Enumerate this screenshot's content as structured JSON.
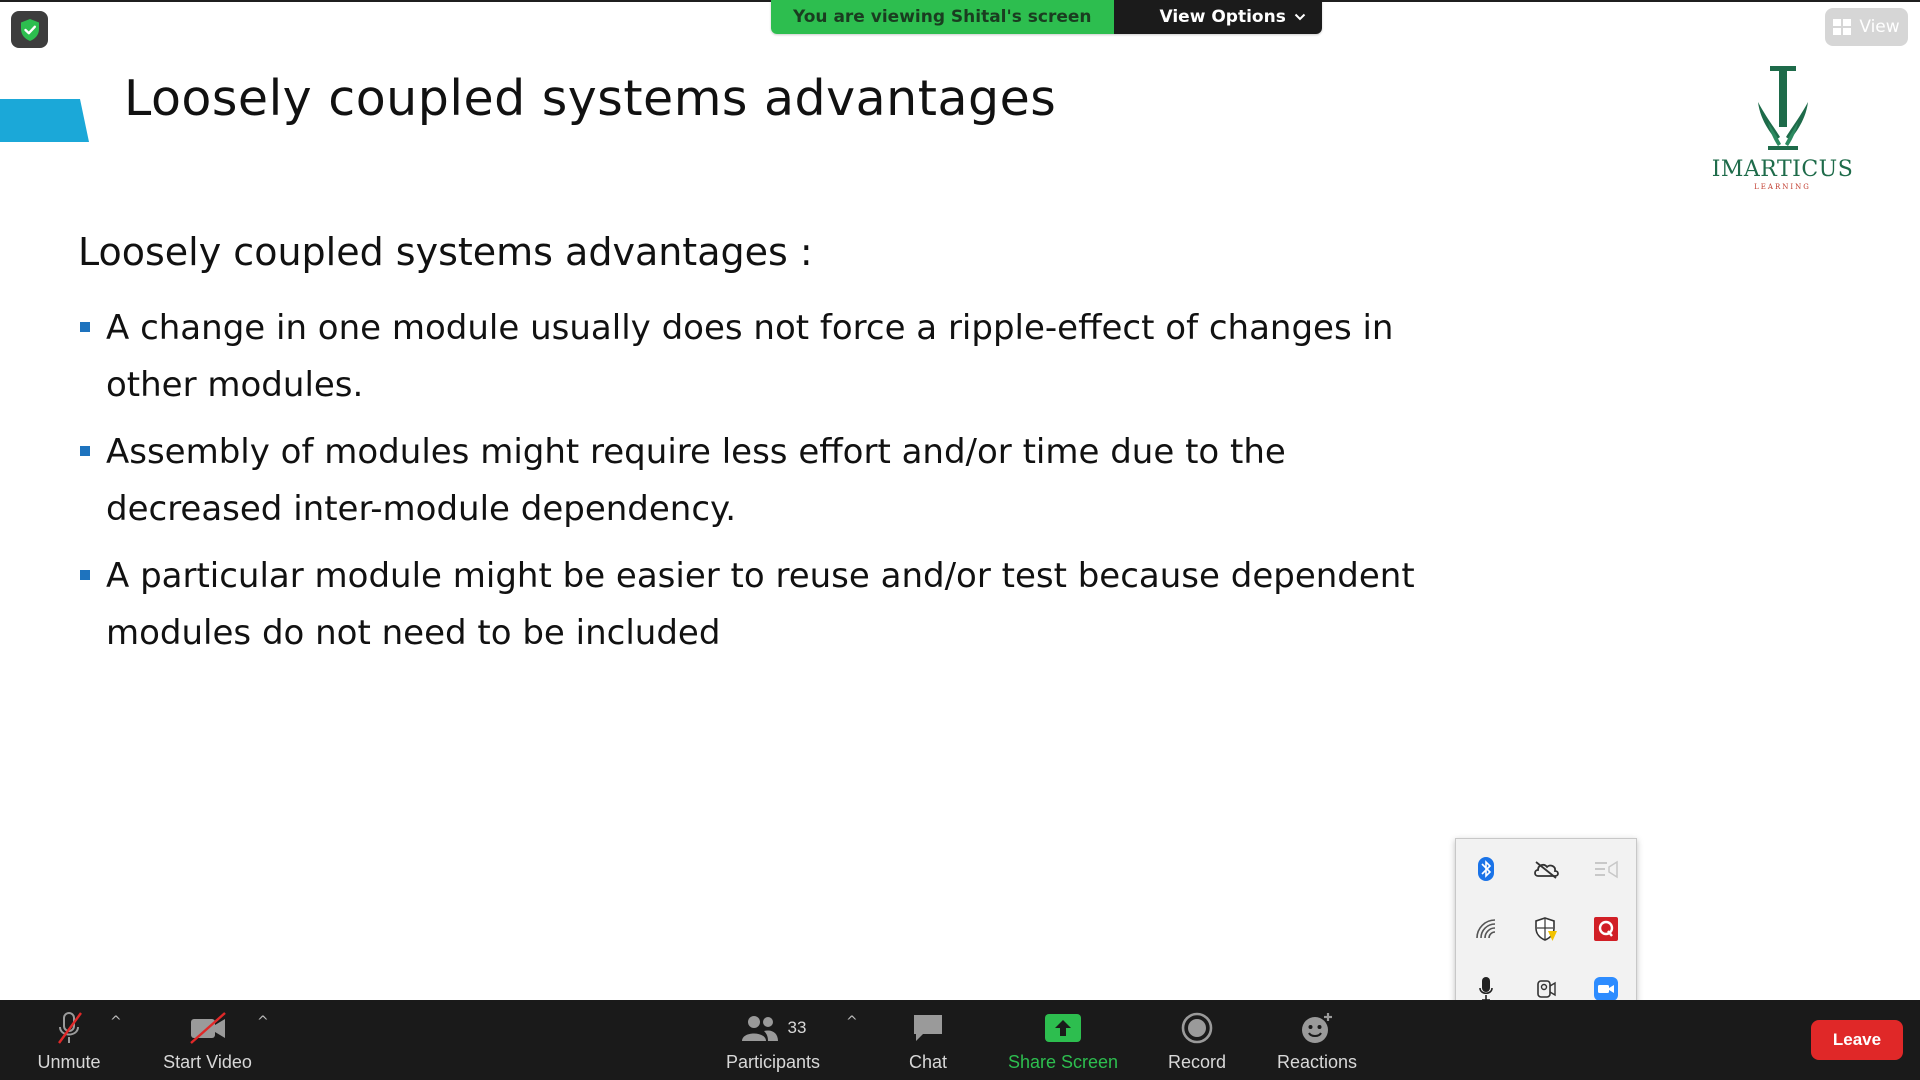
{
  "banner": {
    "status_text": "You are viewing Shital's screen",
    "view_options_label": "View Options"
  },
  "top_right": {
    "view_label": "View"
  },
  "slide": {
    "title": "Loosely coupled systems advantages",
    "heading": "Loosely coupled systems advantages :",
    "bullets": [
      "A change in one module usually does not force a ripple-effect of changes in other modules.",
      "Assembly of modules might require less effort and/or time due to the decreased inter-module dependency.",
      "A particular module might be easier to reuse and/or test because dependent modules do not need to be included"
    ],
    "logo_text": "IMARTICUS",
    "logo_subtext": "LEARNING",
    "accent_color": "#1ba8d8"
  },
  "tray": {
    "icons": [
      "bluetooth-icon",
      "onedrive-offline-icon",
      "presentation-icon",
      "network-icon",
      "windows-security-icon",
      "q-app-icon",
      "microphone-icon",
      "camera-icon",
      "zoom-icon"
    ]
  },
  "toolbar": {
    "unmute_label": "Unmute",
    "start_video_label": "Start Video",
    "participants_label": "Participants",
    "participants_count": "33",
    "chat_label": "Chat",
    "share_screen_label": "Share Screen",
    "record_label": "Record",
    "reactions_label": "Reactions",
    "leave_label": "Leave"
  },
  "colors": {
    "share_green": "#2dbe4f",
    "toolbar_bg": "#1a1a1a",
    "leave_red": "#e02828",
    "bullet_blue": "#1e73be"
  }
}
